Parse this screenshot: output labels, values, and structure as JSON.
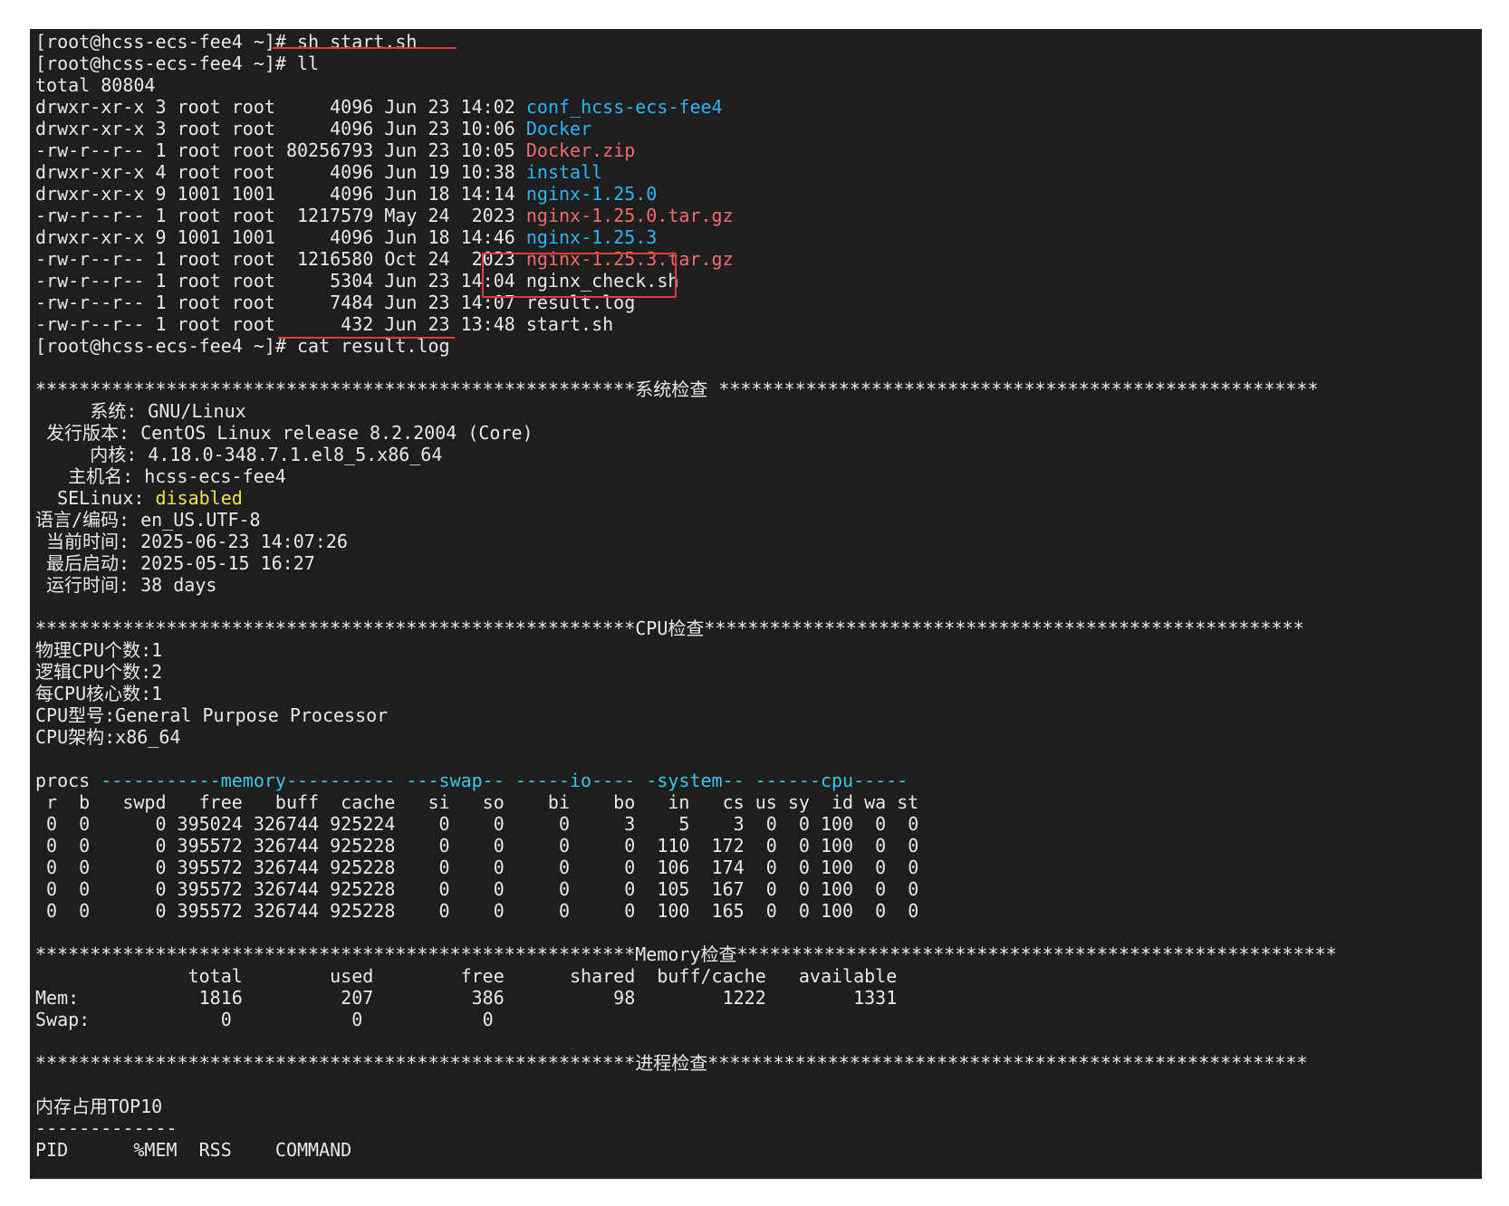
{
  "colors": {
    "background": "#1e1e1e",
    "text": "#e8e8e8",
    "directory": "#29b6f6",
    "archive": "#f26b6b",
    "selinux_value": "#f0e442",
    "vmstat_section": "#3ac6e8",
    "annotation": "#e03c3c"
  },
  "lines": [
    [
      {
        "t": "[root@hcss-ecs-fee4 ~]# sh start.sh"
      }
    ],
    [
      {
        "t": "[root@hcss-ecs-fee4 ~]# ll"
      }
    ],
    [
      {
        "t": "total 80804"
      }
    ],
    [
      {
        "t": "drwxr-xr-x 3 root root     4096 Jun 23 14:02 "
      },
      {
        "t": "conf_hcss-ecs-fee4",
        "c": "dir"
      }
    ],
    [
      {
        "t": "drwxr-xr-x 3 root root     4096 Jun 23 10:06 "
      },
      {
        "t": "Docker",
        "c": "dir"
      }
    ],
    [
      {
        "t": "-rw-r--r-- 1 root root 80256793 Jun 23 10:05 "
      },
      {
        "t": "Docker.zip",
        "c": "zip"
      }
    ],
    [
      {
        "t": "drwxr-xr-x 4 root root     4096 Jun 19 10:38 "
      },
      {
        "t": "install",
        "c": "dir"
      }
    ],
    [
      {
        "t": "drwxr-xr-x 9 1001 1001     4096 Jun 18 14:14 "
      },
      {
        "t": "nginx-1.25.0",
        "c": "dir"
      }
    ],
    [
      {
        "t": "-rw-r--r-- 1 root root  1217579 May 24  2023 "
      },
      {
        "t": "nginx-1.25.0.tar.gz",
        "c": "zip"
      }
    ],
    [
      {
        "t": "drwxr-xr-x 9 1001 1001     4096 Jun 18 14:46 "
      },
      {
        "t": "nginx-1.25.3",
        "c": "dir"
      }
    ],
    [
      {
        "t": "-rw-r--r-- 1 root root  1216580 Oct 24  2023 "
      },
      {
        "t": "nginx-1.25.3.tar.gz",
        "c": "zip"
      }
    ],
    [
      {
        "t": "-rw-r--r-- 1 root root     5304 Jun 23 14:04 nginx_check.sh"
      }
    ],
    [
      {
        "t": "-rw-r--r-- 1 root root     7484 Jun 23 14:07 result.log"
      }
    ],
    [
      {
        "t": "-rw-r--r-- 1 root root      432 Jun 23 13:48 start.sh"
      }
    ],
    [
      {
        "t": "[root@hcss-ecs-fee4 ~]# cat result.log"
      }
    ],
    [
      {
        "t": ""
      }
    ],
    [
      {
        "t": "*******************************************************系统检查 *******************************************************"
      }
    ],
    [
      {
        "t": "     系统: GNU/Linux"
      }
    ],
    [
      {
        "t": " 发行版本: CentOS Linux release 8.2.2004 (Core)"
      }
    ],
    [
      {
        "t": "     内核: 4.18.0-348.7.1.el8_5.x86_64"
      }
    ],
    [
      {
        "t": "   主机名: hcss-ecs-fee4"
      }
    ],
    [
      {
        "t": "  SELinux: "
      },
      {
        "t": "disabled",
        "c": "sel"
      }
    ],
    [
      {
        "t": "语言/编码: en_US.UTF-8"
      }
    ],
    [
      {
        "t": " 当前时间: 2025-06-23 14:07:26"
      }
    ],
    [
      {
        "t": " 最后启动: 2025-05-15 16:27"
      }
    ],
    [
      {
        "t": " 运行时间: 38 days"
      }
    ],
    [
      {
        "t": ""
      }
    ],
    [
      {
        "t": "*******************************************************CPU检查*******************************************************"
      }
    ],
    [
      {
        "t": "物理CPU个数:1"
      }
    ],
    [
      {
        "t": "逻辑CPU个数:2"
      }
    ],
    [
      {
        "t": "每CPU核心数:1"
      }
    ],
    [
      {
        "t": "CPU型号:General Purpose Processor"
      }
    ],
    [
      {
        "t": "CPU架构:x86_64"
      }
    ],
    [
      {
        "t": ""
      }
    ],
    [
      {
        "t": "procs "
      },
      {
        "t": "-----------memory---------- ---swap-- -----io---- -system-- ------cpu-----",
        "c": "sec"
      }
    ],
    [
      {
        "t": " r  b   swpd   free   buff  cache   si   so    bi    bo   in   cs us sy  id wa st"
      }
    ],
    [
      {
        "t": " 0  0      0 395024 326744 925224    0    0     0     3    5    3  0  0 100  0  0"
      }
    ],
    [
      {
        "t": " 0  0      0 395572 326744 925228    0    0     0     0  110  172  0  0 100  0  0"
      }
    ],
    [
      {
        "t": " 0  0      0 395572 326744 925228    0    0     0     0  106  174  0  0 100  0  0"
      }
    ],
    [
      {
        "t": " 0  0      0 395572 326744 925228    0    0     0     0  105  167  0  0 100  0  0"
      }
    ],
    [
      {
        "t": " 0  0      0 395572 326744 925228    0    0     0     0  100  165  0  0 100  0  0"
      }
    ],
    [
      {
        "t": ""
      }
    ],
    [
      {
        "t": "*******************************************************Memory检查*******************************************************"
      }
    ],
    [
      {
        "t": "              total        used        free      shared  buff/cache   available"
      }
    ],
    [
      {
        "t": "Mem:           1816         207         386          98        1222        1331"
      }
    ],
    [
      {
        "t": "Swap:            0           0           0"
      }
    ],
    [
      {
        "t": ""
      }
    ],
    [
      {
        "t": "*******************************************************进程检查*******************************************************"
      }
    ],
    [
      {
        "t": ""
      }
    ],
    [
      {
        "t": "内存占用TOP10"
      }
    ],
    [
      {
        "t": "-------------"
      }
    ],
    [
      {
        "t": "PID      %MEM  RSS    COMMAND"
      }
    ]
  ]
}
